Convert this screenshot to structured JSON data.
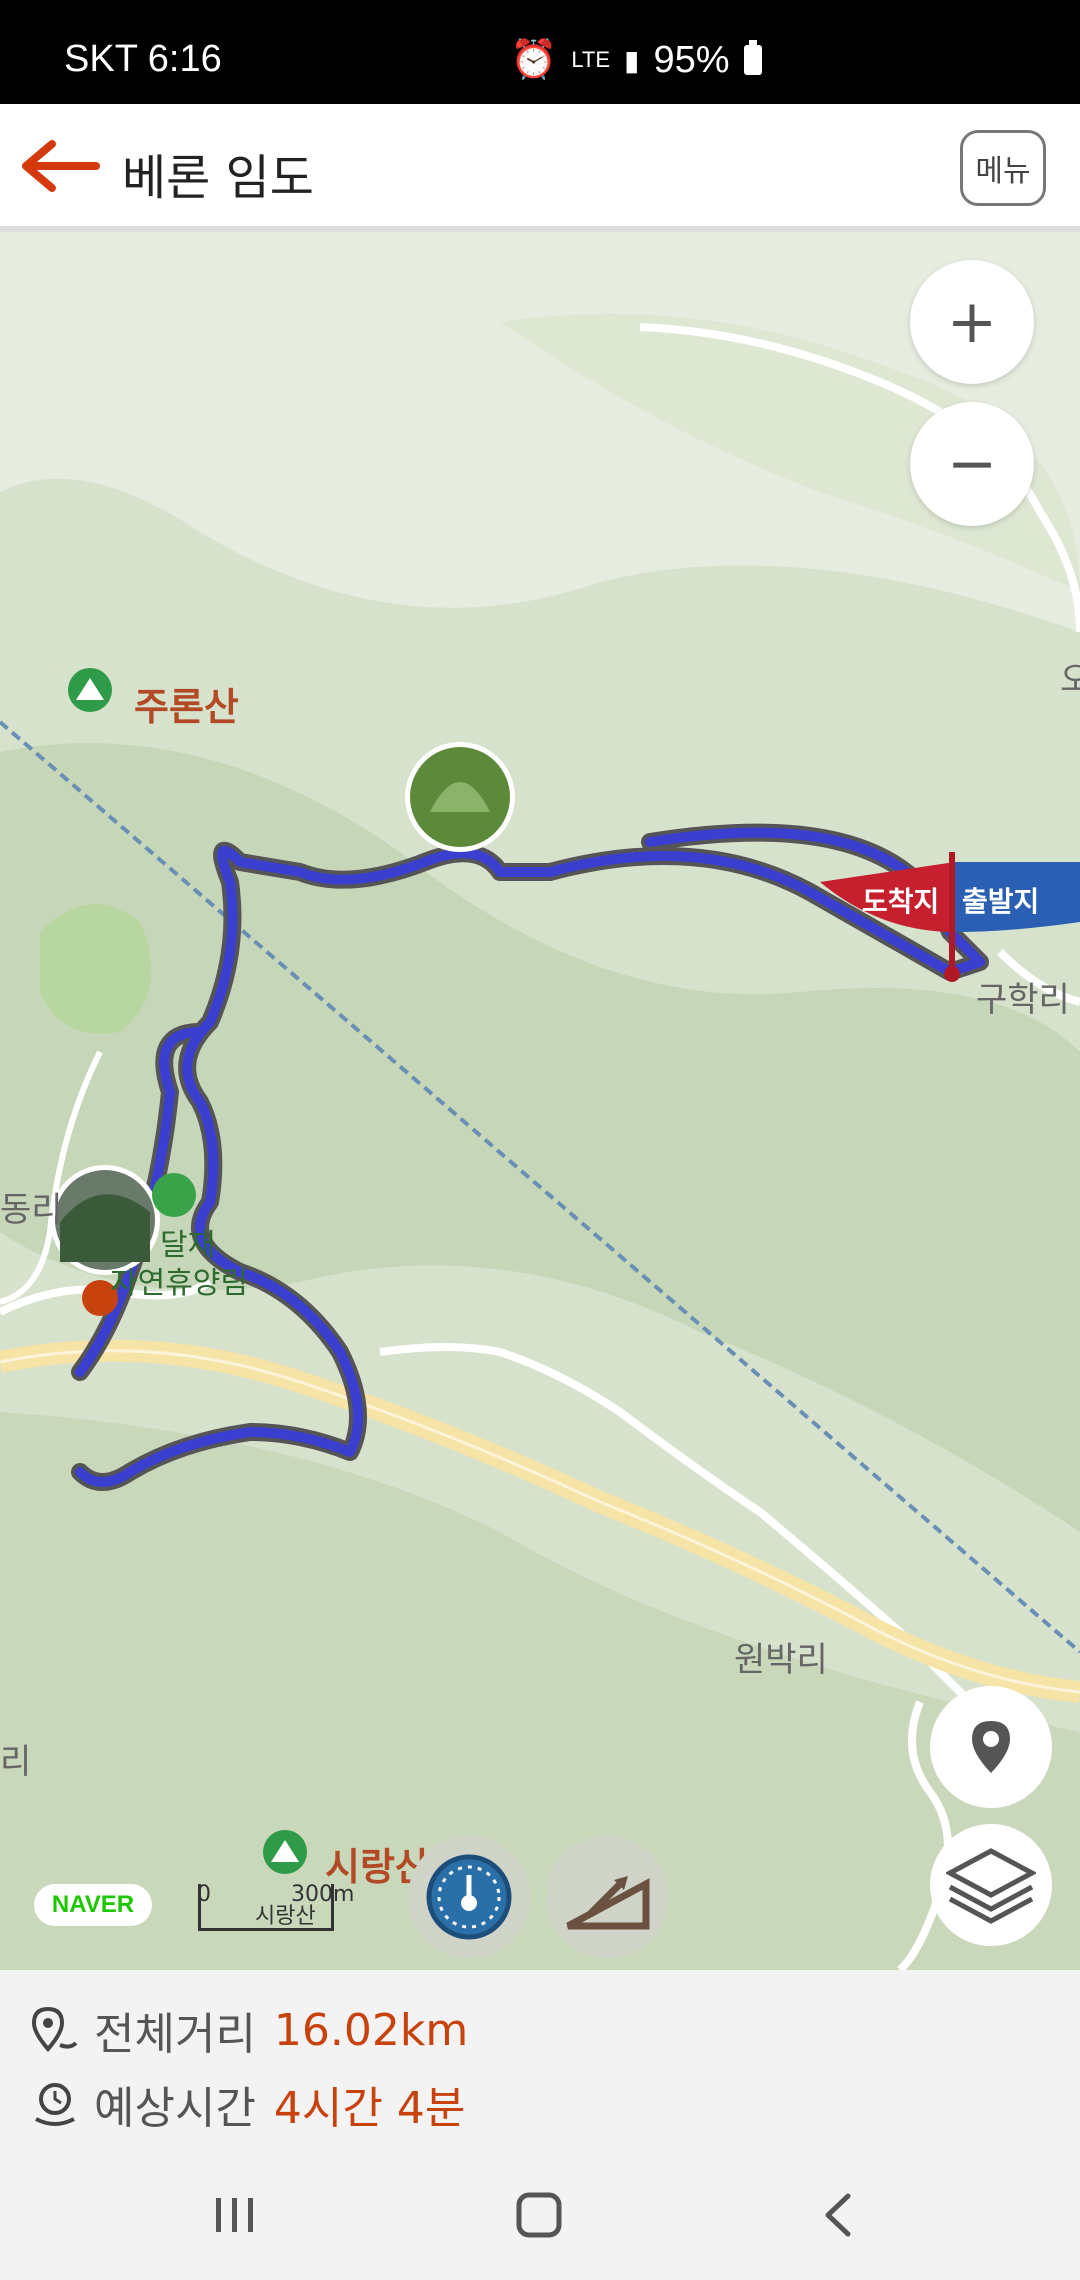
{
  "status_bar": {
    "carrier_time": "SKT 6:16",
    "network": "LTE",
    "battery": "95%"
  },
  "header": {
    "title": "베론 임도",
    "menu_label": "메뉴"
  },
  "map": {
    "mountains": [
      "주론산",
      "시랑산"
    ],
    "places": [
      "달재",
      "자연휴양림",
      "구학리",
      "원박리",
      "동리",
      "리",
      "오"
    ],
    "flag_start": "출발지",
    "flag_end": "도착지",
    "zoom_in": "+",
    "zoom_out": "−",
    "brand": "NAVER",
    "scale_zero": "0",
    "scale_value": "300m",
    "scale_place": "시랑산"
  },
  "summary": {
    "distance_label": "전체거리",
    "distance_value": "16.02km",
    "time_label": "예상시간",
    "time_value": "4시간 4분"
  },
  "colors": {
    "accent": "#c8420d",
    "route": "#3a3fd0",
    "map_bg": "#d7e2cd"
  },
  "icons": [
    "arrow-left-icon",
    "location-pin-icon",
    "layers-icon",
    "speedometer-icon",
    "elevation-icon",
    "distance-icon",
    "time-icon",
    "recents-icon",
    "home-icon",
    "back-nav-icon"
  ]
}
